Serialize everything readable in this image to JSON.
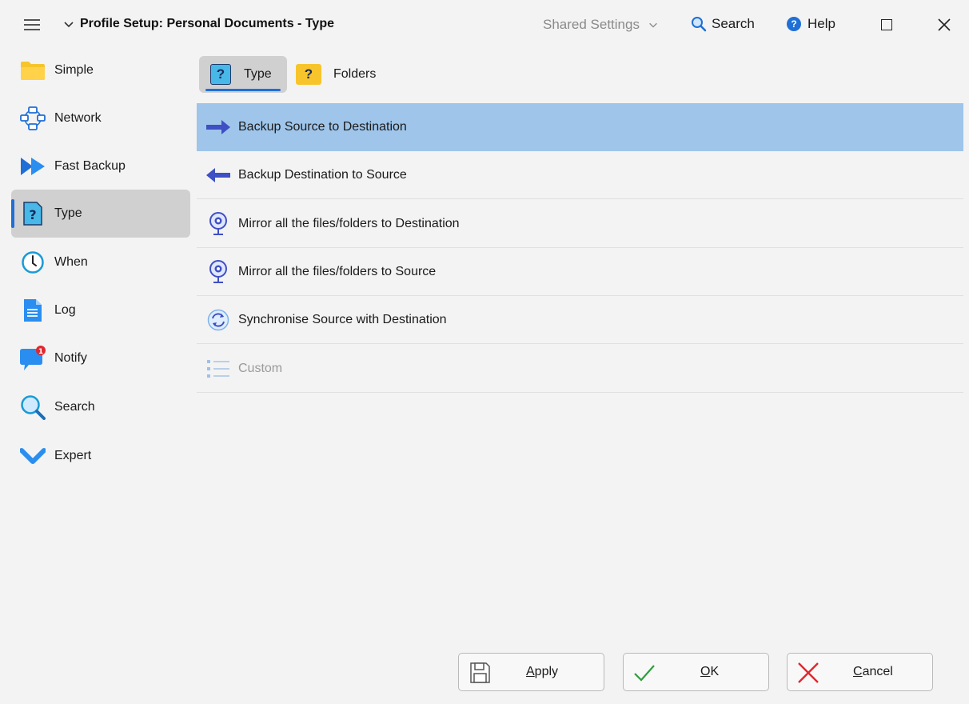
{
  "titlebar": {
    "title": "Profile Setup: Personal Documents - Type",
    "shared_settings": "Shared Settings",
    "search": "Search",
    "help": "Help"
  },
  "sidebar": {
    "items": [
      {
        "label": "Simple",
        "icon": "folder-icon"
      },
      {
        "label": "Network",
        "icon": "network-icon"
      },
      {
        "label": "Fast Backup",
        "icon": "fast-forward-icon"
      },
      {
        "label": "Type",
        "icon": "question-doc-icon",
        "active": true
      },
      {
        "label": "When",
        "icon": "clock-icon"
      },
      {
        "label": "Log",
        "icon": "document-icon"
      },
      {
        "label": "Notify",
        "icon": "chat-bubble-icon",
        "badge": "1"
      },
      {
        "label": "Search",
        "icon": "magnifier-icon"
      },
      {
        "label": "Expert",
        "icon": "chevron-check-icon"
      }
    ]
  },
  "subtabs": [
    {
      "label": "Type",
      "active": true
    },
    {
      "label": "Folders"
    }
  ],
  "options": [
    {
      "label": "Backup Source to Destination",
      "selected": true
    },
    {
      "label": "Backup Destination to Source"
    },
    {
      "label": "Mirror all the files/folders to Destination"
    },
    {
      "label": "Mirror all the files/folders to Source"
    },
    {
      "label": "Synchronise Source with Destination"
    },
    {
      "label": "Custom",
      "disabled": true
    }
  ],
  "buttons": {
    "apply": {
      "mnemonic": "A",
      "rest": "pply"
    },
    "ok": {
      "mnemonic": "O",
      "rest": "K"
    },
    "cancel": {
      "mnemonic": "C",
      "rest": "ancel"
    }
  },
  "colors": {
    "accent": "#1f6fd6",
    "selected_row": "#9fc5ea",
    "arrow_blue": "#3f4fc4",
    "ok_green": "#2e9e3e",
    "cancel_red": "#e0282e"
  }
}
